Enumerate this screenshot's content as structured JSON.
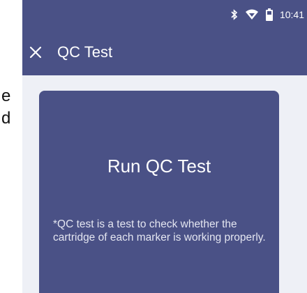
{
  "background_doc": {
    "line1": "e",
    "line2": "d"
  },
  "status_bar": {
    "time": "10:41",
    "icons": [
      "bluetooth-icon",
      "wifi-icon",
      "battery-icon"
    ]
  },
  "app_bar": {
    "title": "QC Test",
    "close_icon": "close-icon"
  },
  "card": {
    "title": "Run QC Test",
    "note": "*QC test is a test to check whether the cartridge of each marker is working properly."
  },
  "colors": {
    "primary": "#4a5186",
    "background": "#eef0f6",
    "text_on_primary": "#ffffff"
  }
}
